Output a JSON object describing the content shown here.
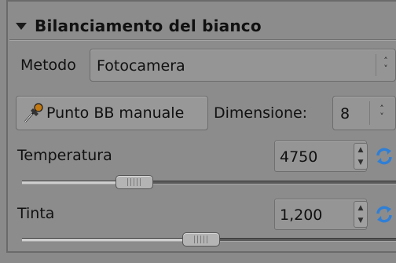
{
  "panel": {
    "title": "Bilanciamento del bianco"
  },
  "method": {
    "label": "Metodo",
    "value": "Fotocamera"
  },
  "picker": {
    "button_label": "Punto BB manuale",
    "size_label": "Dimensione:",
    "size_value": "8"
  },
  "temperature": {
    "label": "Temperatura",
    "value": "4750",
    "slider_fraction": 0.3
  },
  "tint": {
    "label": "Tinta",
    "value": "1,200",
    "slider_fraction": 0.48
  },
  "icons": {
    "collapse": "triangle-down-icon",
    "picker": "eyedropper-icon",
    "reset": "refresh-icon"
  },
  "colors": {
    "panel_bg": "#8c8c8c",
    "reset_icon": "#2f7fd6"
  }
}
